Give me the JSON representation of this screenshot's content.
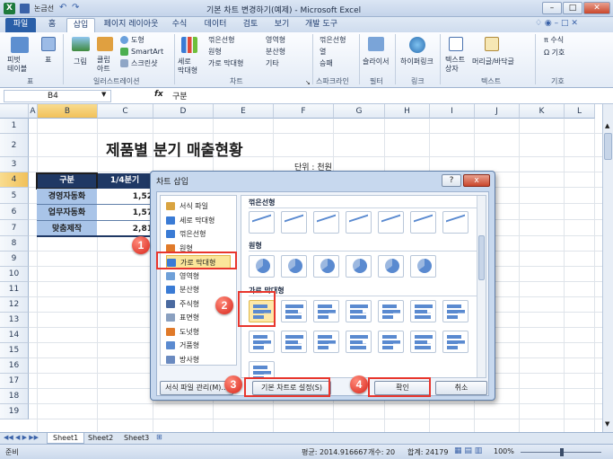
{
  "window": {
    "title": "기본 차트 변경하기(예제) - Microsoft Excel",
    "qat_label": "논금선"
  },
  "tabs": [
    "파일",
    "홈",
    "삽입",
    "페이지 레이아웃",
    "수식",
    "데이터",
    "검토",
    "보기",
    "개발 도구"
  ],
  "ribbon": {
    "pivot": "피벗\n테이블",
    "table": "표",
    "picture": "그림",
    "clipart": "클립\n아트",
    "shapes": "도형",
    "smartart": "SmartArt",
    "screenshot": "스크린샷",
    "column": "세로\n막대형",
    "line": "꺾은선형",
    "pie": "원형",
    "bar": "가로 막대형",
    "area": "영역형",
    "scatter": "분산형",
    "other": "기타",
    "spark_line": "꺾은선형",
    "spark_col": "열",
    "spark_wl": "승패",
    "slicer": "슬라이서",
    "hyperlink": "하이퍼링크",
    "textbox": "텍스트\n상자",
    "header": "머리글/바닥글",
    "equation": "수식",
    "symbol": "기호",
    "groups": {
      "tables": "표",
      "illustrations": "일러스트레이션",
      "charts": "차트",
      "sparklines": "스파크라인",
      "filter": "필터",
      "links": "링크",
      "text": "텍스트",
      "symbols": "기호"
    }
  },
  "formula_bar": {
    "name_box": "B4",
    "fx": "fx",
    "content": "구분"
  },
  "columns": [
    "A",
    "B",
    "C",
    "D",
    "E",
    "F",
    "G",
    "H",
    "I",
    "J",
    "K",
    "L"
  ],
  "rows": [
    "1",
    "2",
    "3",
    "4",
    "5",
    "6",
    "7",
    "8",
    "9",
    "10",
    "11",
    "12",
    "13",
    "14",
    "15",
    "16",
    "17",
    "18",
    "19"
  ],
  "sheet": {
    "title": "제품별 분기 매출현황",
    "unit": "단위 : 천원",
    "header": [
      "구분",
      "1/4분기"
    ],
    "rows": [
      {
        "label": "경영자동화",
        "value": "1,52"
      },
      {
        "label": "업무자동화",
        "value": "1,57"
      },
      {
        "label": "맞춤제작",
        "value": "2,81"
      }
    ]
  },
  "dialog": {
    "title": "차트 삽입",
    "help": "?",
    "close": "x",
    "categories": [
      "서식 파일",
      "세로 막대형",
      "꺾은선형",
      "원형",
      "가로 막대형",
      "영역형",
      "분산형",
      "주식형",
      "표면형",
      "도넛형",
      "거품형",
      "방사형"
    ],
    "sections": [
      "꺾은선형",
      "원형",
      "가로 막대형"
    ],
    "manage_btn": "서식 파일 관리(M)...",
    "set_default_btn": "기본 차트로 설정(S)",
    "ok_btn": "확인",
    "cancel_btn": "취소",
    "badges": [
      "1",
      "2",
      "3",
      "4"
    ]
  },
  "sheet_tabs": [
    "Sheet1",
    "Sheet2",
    "Sheet3"
  ],
  "status": {
    "ready": "준비",
    "average": "평균: 2014.916667",
    "count": "개수: 20",
    "sum": "합계: 24179",
    "zoom": "100%"
  },
  "colors": {
    "header_fill": "#1f3864",
    "data_fill": "#a9c4e8",
    "accent_red": "#e8362d",
    "ribbon_blue": "#2a5fa8"
  }
}
